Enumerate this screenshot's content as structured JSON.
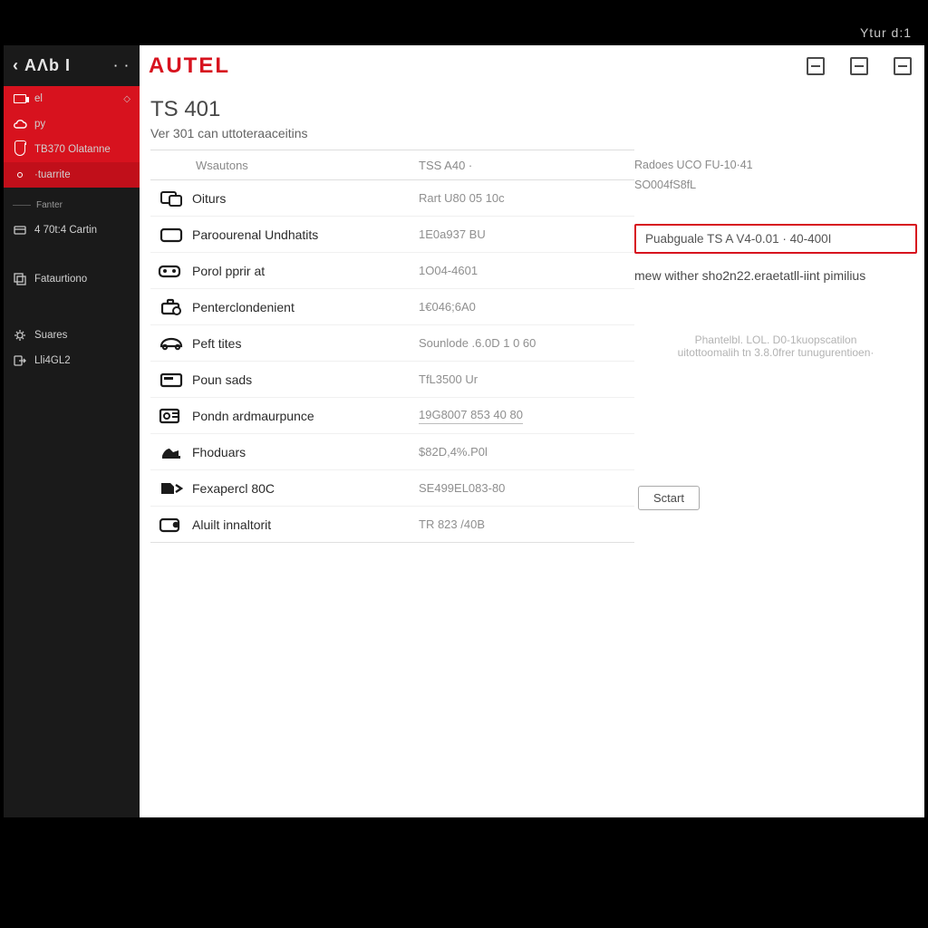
{
  "window": {
    "title": "Ytur d:1"
  },
  "header": {
    "back_symbol": "‹",
    "app_short": "AΛb I",
    "dots": "· ·",
    "brand": "AUTEL"
  },
  "sidebar": {
    "red": [
      {
        "icon": "monitor-icon",
        "label": "el",
        "chev": "◇"
      },
      {
        "icon": "cloud-icon",
        "label": "py"
      },
      {
        "icon": "shield-icon",
        "label": "TB370 Olatanne"
      },
      {
        "icon": "dot-icon",
        "label": "·tuarrite",
        "selected": true
      }
    ],
    "divider1": "Fanter",
    "dark": [
      {
        "icon": "card-icon",
        "label": "4 70t:4 Cartin"
      },
      {
        "icon": "layers-icon",
        "label": "Fataurtiono"
      }
    ],
    "dark2": [
      {
        "icon": "gear-icon",
        "label": "Suares"
      },
      {
        "icon": "logout-icon",
        "label": "Lli4GL2"
      }
    ]
  },
  "page": {
    "title": "TS 401",
    "subtitle": "Ver 301 can uttoteraaceitins"
  },
  "table": {
    "headers": {
      "c2": "Wsautons",
      "c3": "TSS A40 ·"
    },
    "rows": [
      {
        "name": "Oiturs",
        "value": "Rart U80 05 10c"
      },
      {
        "name": "Paroourenal Undhatits",
        "value": "1E0a937 BU"
      },
      {
        "name": "Porol pprir at",
        "value": "1O04-4601"
      },
      {
        "name": "Penterclondenient",
        "value": "1€046;6A0"
      },
      {
        "name": "Peft tites",
        "value": "Sounlode .6.0D 1 0 60"
      },
      {
        "name": "Poun sads",
        "value": "TfL3500 Ur"
      },
      {
        "name": "Pondn ardmaurpunce",
        "value": "19G8007 853 40 80",
        "underlined": true
      },
      {
        "name": "Fhoduars",
        "value": "$82D,4%.P0l"
      },
      {
        "name": "Fexapercl 80C",
        "value": "SE499EL083-80"
      },
      {
        "name": "Aluilt innaltorit",
        "value": "TR 823 /40B"
      }
    ]
  },
  "info": {
    "top_left": "Radoes UCO FU-10·41",
    "top_right_value": "SO004fS8fL",
    "highlight": "Puabguale TS A V4-0.01 · 40-400I",
    "desc": "mew wither sho2n22.eraetatll-iint pimilius",
    "fine1": "Phantelbl. LOL. D0-1kuopscatilon",
    "fine2": "uitottoomalih tn 3.8.0frer tunugurentioen·",
    "start_label": "Sctart"
  }
}
